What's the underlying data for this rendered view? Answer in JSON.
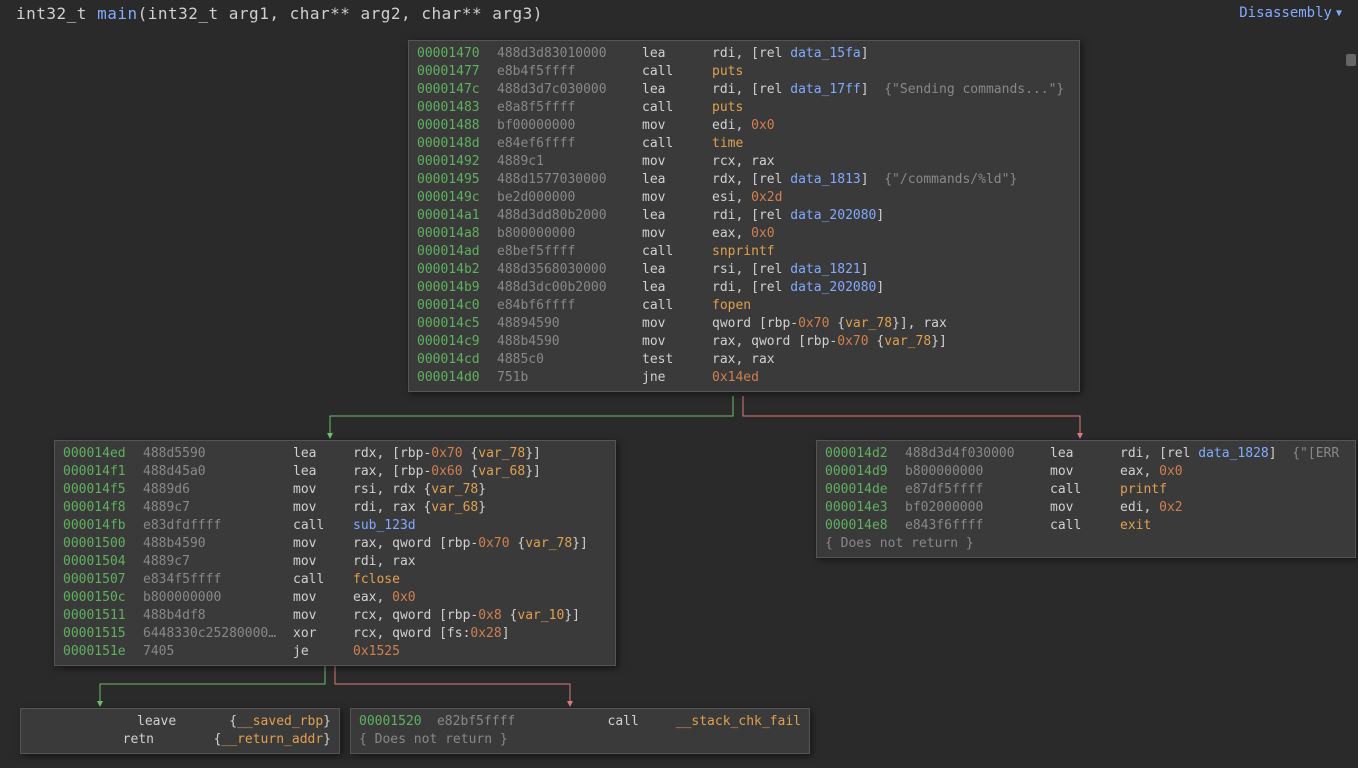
{
  "header": {
    "signature_prefix": "int32_t ",
    "func_name": "main",
    "signature_args": "(int32_t arg1, char** arg2, char** arg3)",
    "view_label": "Disassembly"
  },
  "blocks": {
    "main": [
      {
        "addr": "00001470",
        "bytes": "488d3d83010000",
        "mnem": "lea",
        "ops": "rdi, [rel ",
        "ref": "data_15fa",
        "tail": "]"
      },
      {
        "addr": "00001477",
        "bytes": "e8b4f5ffff",
        "mnem": "call",
        "func": "puts"
      },
      {
        "addr": "0000147c",
        "bytes": "488d3d7c030000",
        "mnem": "lea",
        "ops": "rdi, [rel ",
        "ref": "data_17ff",
        "tail": "]",
        "str": "  {\"Sending commands...\"}"
      },
      {
        "addr": "00001483",
        "bytes": "e8a8f5ffff",
        "mnem": "call",
        "func": "puts"
      },
      {
        "addr": "00001488",
        "bytes": "bf00000000",
        "mnem": "mov",
        "ops": "edi, ",
        "num": "0x0"
      },
      {
        "addr": "0000148d",
        "bytes": "e84ef6ffff",
        "mnem": "call",
        "func": "time"
      },
      {
        "addr": "00001492",
        "bytes": "4889c1",
        "mnem": "mov",
        "ops": "rcx, rax"
      },
      {
        "addr": "00001495",
        "bytes": "488d1577030000",
        "mnem": "lea",
        "ops": "rdx, [rel ",
        "ref": "data_1813",
        "tail": "]",
        "str": "  {\"/commands/%ld\"}"
      },
      {
        "addr": "0000149c",
        "bytes": "be2d000000",
        "mnem": "mov",
        "ops": "esi, ",
        "num": "0x2d"
      },
      {
        "addr": "000014a1",
        "bytes": "488d3dd80b2000",
        "mnem": "lea",
        "ops": "rdi, [rel ",
        "ref": "data_202080",
        "tail": "]"
      },
      {
        "addr": "000014a8",
        "bytes": "b800000000",
        "mnem": "mov",
        "ops": "eax, ",
        "num": "0x0"
      },
      {
        "addr": "000014ad",
        "bytes": "e8bef5ffff",
        "mnem": "call",
        "func": "snprintf"
      },
      {
        "addr": "000014b2",
        "bytes": "488d3568030000",
        "mnem": "lea",
        "ops": "rsi, [rel ",
        "ref": "data_1821",
        "tail": "]"
      },
      {
        "addr": "000014b9",
        "bytes": "488d3dc00b2000",
        "mnem": "lea",
        "ops": "rdi, [rel ",
        "ref": "data_202080",
        "tail": "]"
      },
      {
        "addr": "000014c0",
        "bytes": "e84bf6ffff",
        "mnem": "call",
        "func": "fopen"
      },
      {
        "addr": "000014c5",
        "bytes": "48894590",
        "mnem": "mov",
        "ops": "qword [rbp-",
        "num": "0x70",
        "tail2": " {",
        "var": "var_78",
        "tail3": "}], rax"
      },
      {
        "addr": "000014c9",
        "bytes": "488b4590",
        "mnem": "mov",
        "ops": "rax, qword [rbp-",
        "num": "0x70",
        "tail2": " {",
        "var": "var_78",
        "tail3": "}]"
      },
      {
        "addr": "000014cd",
        "bytes": "4885c0",
        "mnem": "test",
        "ops": "rax, rax"
      },
      {
        "addr": "000014d0",
        "bytes": "751b",
        "mnem": "jne",
        "num": "0x14ed"
      }
    ],
    "left": [
      {
        "addr": "000014ed",
        "bytes": "488d5590",
        "mnem": "lea",
        "ops": "rdx, [rbp-",
        "num": "0x70",
        "tail2": " {",
        "var": "var_78",
        "tail3": "}]"
      },
      {
        "addr": "000014f1",
        "bytes": "488d45a0",
        "mnem": "lea",
        "ops": "rax, [rbp-",
        "num": "0x60",
        "tail2": " {",
        "var": "var_68",
        "tail3": "}]"
      },
      {
        "addr": "000014f5",
        "bytes": "4889d6",
        "mnem": "mov",
        "ops": "rsi, rdx {",
        "var": "var_78",
        "tail3": "}"
      },
      {
        "addr": "000014f8",
        "bytes": "4889c7",
        "mnem": "mov",
        "ops": "rdi, rax {",
        "var": "var_68",
        "tail3": "}"
      },
      {
        "addr": "000014fb",
        "bytes": "e83dfdffff",
        "mnem": "call",
        "ref": "sub_123d"
      },
      {
        "addr": "00001500",
        "bytes": "488b4590",
        "mnem": "mov",
        "ops": "rax, qword [rbp-",
        "num": "0x70",
        "tail2": " {",
        "var": "var_78",
        "tail3": "}]"
      },
      {
        "addr": "00001504",
        "bytes": "4889c7",
        "mnem": "mov",
        "ops": "rdi, rax"
      },
      {
        "addr": "00001507",
        "bytes": "e834f5ffff",
        "mnem": "call",
        "func": "fclose"
      },
      {
        "addr": "0000150c",
        "bytes": "b800000000",
        "mnem": "mov",
        "ops": "eax, ",
        "num": "0x0"
      },
      {
        "addr": "00001511",
        "bytes": "488b4df8",
        "mnem": "mov",
        "ops": "rcx, qword [rbp-",
        "num": "0x8",
        "tail2": " {",
        "var": "var_10",
        "tail3": "}]"
      },
      {
        "addr": "00001515",
        "bytes": "6448330c25280000…",
        "mnem": "xor",
        "ops": "rcx, qword [fs:",
        "num": "0x28",
        "tail3": "]"
      },
      {
        "addr": "0000151e",
        "bytes": "7405",
        "mnem": "je",
        "num": "0x1525"
      }
    ],
    "right": [
      {
        "addr": "000014d2",
        "bytes": "488d3d4f030000",
        "mnem": "lea",
        "ops": "rdi, [rel ",
        "ref": "data_1828",
        "tail": "]",
        "str": "  {\"[ERR"
      },
      {
        "addr": "000014d9",
        "bytes": "b800000000",
        "mnem": "mov",
        "ops": "eax, ",
        "num": "0x0"
      },
      {
        "addr": "000014de",
        "bytes": "e87df5ffff",
        "mnem": "call",
        "func": "printf"
      },
      {
        "addr": "000014e3",
        "bytes": "bf02000000",
        "mnem": "mov",
        "ops": "edi, ",
        "num": "0x2"
      },
      {
        "addr": "000014e8",
        "bytes": "e843f6ffff",
        "mnem": "call",
        "func": "exit"
      }
    ],
    "right_note": "{ Does not return }",
    "bottomleft": [
      {
        "mnem": "leave",
        "tail2": "   {",
        "var": "__saved_rbp",
        "tail3": "}"
      },
      {
        "mnem": "retn",
        "tail2": "    {",
        "var": "__return_addr",
        "tail3": "}"
      }
    ],
    "bottomright": [
      {
        "addr": "00001520",
        "bytes": "e82bf5ffff",
        "mnem": "call",
        "func": "__stack_chk_fail"
      }
    ],
    "bottomright_note": "{ Does not return }"
  }
}
